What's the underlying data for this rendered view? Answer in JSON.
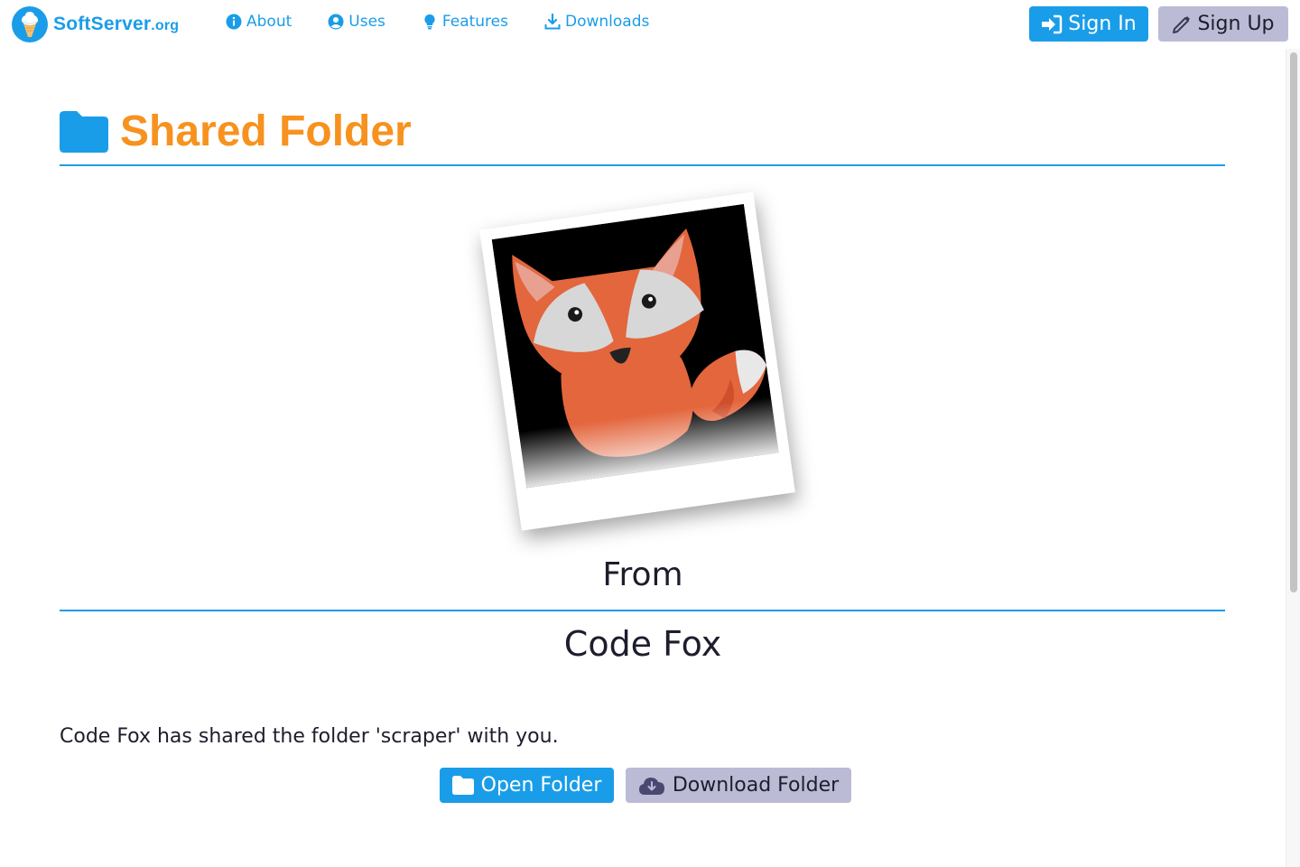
{
  "brand": {
    "name": "SoftServer",
    "tld": ".org",
    "logo_icon": "ice-cream-icon"
  },
  "nav": {
    "links": [
      {
        "label": "About",
        "icon": "info-circle-icon"
      },
      {
        "label": "Uses",
        "icon": "user-circle-icon"
      },
      {
        "label": "Features",
        "icon": "lightbulb-icon"
      },
      {
        "label": "Downloads",
        "icon": "download-icon"
      }
    ],
    "sign_in": {
      "label": "Sign In",
      "icon": "sign-in-icon"
    },
    "sign_up": {
      "label": "Sign Up",
      "icon": "pencil-icon"
    }
  },
  "page": {
    "title": "Shared Folder",
    "title_icon": "folder-icon",
    "avatar": "fox-avatar",
    "from_label": "From",
    "owner_name": "Code Fox",
    "message": "Code Fox has shared the folder 'scraper' with you.",
    "open_button": {
      "label": "Open Folder",
      "icon": "folder-icon"
    },
    "download_button": {
      "label": "Download Folder",
      "icon": "cloud-download-icon"
    }
  },
  "colors": {
    "primary": "#1a9de8",
    "accent": "#f7921e",
    "secondary": "#bcbbd6",
    "text": "#1d1d2c"
  }
}
